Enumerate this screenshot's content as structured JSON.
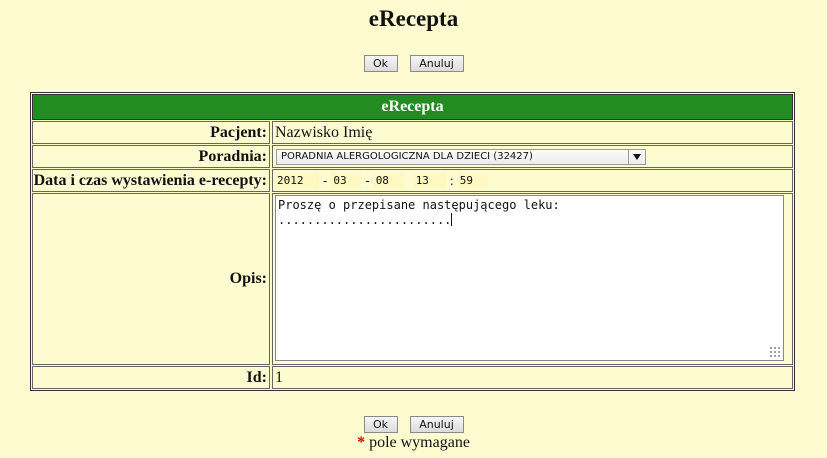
{
  "page": {
    "title": "eRecepta"
  },
  "buttons": {
    "ok_label": "Ok",
    "cancel_label": "Anuluj"
  },
  "form": {
    "header": "eRecepta",
    "patient_label": "Pacjent:",
    "patient_value": "Nazwisko Imię",
    "clinic_label": "Poradnia:",
    "clinic_value": "PORADNIA ALERGOLOGICZNA DLA DZIECI (32427)",
    "datetime_label": "Data i czas wystawienia e-recepty:",
    "datetime": {
      "year": "2012",
      "month": "03",
      "day": "08",
      "hour": "13",
      "minute": "59",
      "date_sep": "-",
      "time_sep": ":"
    },
    "description_label": "Opis:",
    "description_value": "Proszę o przepisane następującego leku:\n........................",
    "id_label": "Id:",
    "id_value": "1"
  },
  "footer": {
    "required_star": "*",
    "required_text": " pole wymagane"
  },
  "colors": {
    "background": "#fffbd0",
    "header_bg": "#228b22",
    "required_star": "#dd0000"
  },
  "icons": {
    "select_arrow": "chevron-down-icon",
    "resize_grip": "resize-grip-icon"
  }
}
